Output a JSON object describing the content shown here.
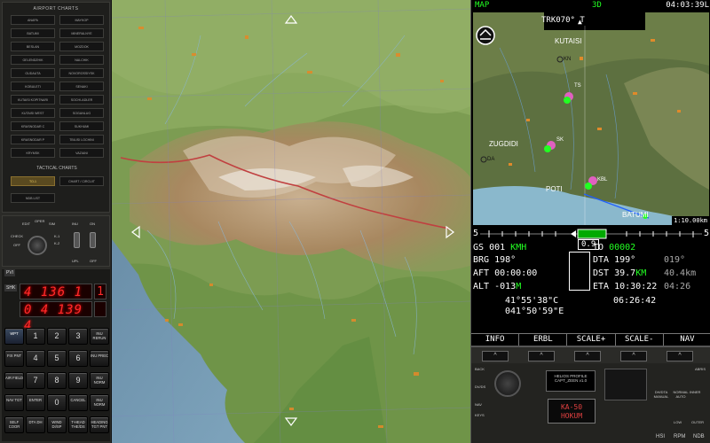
{
  "airport_charts": {
    "header": "AIRPORT CHARTS",
    "buttons": [
      [
        "ANAPA",
        "MAYKOP"
      ],
      [
        "BATUMI",
        "MINERALNYE"
      ],
      [
        "BESLAN",
        "MOZDOK"
      ],
      [
        "GELENDZHIK",
        "NALCHIK"
      ],
      [
        "GUDAUTA",
        "NOVOROSSIYSK"
      ],
      [
        "KOBULETI",
        "SENAKI"
      ],
      [
        "KUTAISI KOPITNARI",
        "SOCHI-ADLER"
      ],
      [
        "KUTAISI WEST",
        "SOGANLUG"
      ],
      [
        "KRASNODAR C",
        "SUKHUMI"
      ],
      [
        "KRASNODAR P",
        "TBILISI LOCHINI"
      ],
      [
        "KRYMSK",
        "VAZIANI"
      ]
    ]
  },
  "tactical_charts": {
    "header": "TACTICAL CHARTS",
    "buttons": [
      "TO-1",
      "CHART / CIRCUIT",
      "NDB LIST"
    ]
  },
  "mode_panel": {
    "labels": [
      "EDIT",
      "OPER",
      "SIM",
      "INU",
      "ON",
      "CHECK",
      "OFF",
      "K-1",
      "K-2",
      "UPL",
      "OFF"
    ]
  },
  "pvi": {
    "tag1": "PVI",
    "tag2": "SHK",
    "display1": "4 136 1",
    "display1r": "1",
    "display2": "0 4 139 4",
    "display2r": "",
    "keys": [
      [
        "WPT",
        "1",
        "2",
        "3",
        "INU RERUN"
      ],
      [
        "FIX PNT",
        "4",
        "5",
        "6",
        "INU PREC"
      ],
      [
        "AIR FIELD",
        "7",
        "8",
        "9",
        "INU NORM"
      ],
      [
        "NAV TGT",
        "ENTER",
        "0",
        "CANCEL",
        "INU NORM"
      ],
      [
        "SELF COOR",
        "DTA DH",
        "WIND DI/SP",
        "T-HEAD THE/DS",
        "HEADING TGT PNT"
      ]
    ]
  },
  "abris": {
    "mode": "MAP",
    "dim": "3D",
    "time": "04:03:39L",
    "track_label": "TRK",
    "track": "070° T",
    "scale": "1:10.00km",
    "places": [
      "KUTAISI",
      "ZUGDIDI",
      "POTI",
      "BATUMI"
    ],
    "wpts": [
      "KN",
      "TS",
      "SK",
      "DA",
      "KBL"
    ],
    "tape_left": "5",
    "tape_right": "5",
    "gs_label": "GS",
    "gs": "001",
    "gs_unit": "KMH",
    "brg_label": "BRG",
    "brg": "198°",
    "aft_label": "AFT",
    "aft": "00:00:00",
    "alt_label": "ALT",
    "alt": "-013",
    "alt_unit": "M",
    "lat": "41°55'38\"C",
    "lon": "041°50'59\"E",
    "dist_box": "0.9",
    "to_label": "TO",
    "to": "00002",
    "dta_label": "DTA",
    "dta": "199°",
    "dta2": "019°",
    "dst_label": "DST",
    "dst": "39.7",
    "dst_unit": "KM",
    "dst2": "40.4km",
    "eta_label": "ETA",
    "eta": "10:30:22",
    "eta2": "04:26",
    "ete": "06:26:42",
    "softkeys": [
      "INFO",
      "ERBL",
      "SCALE+",
      "SCALE-",
      "NAV"
    ],
    "panel_labels": [
      "BACK",
      "DV/DS",
      "NAV",
      "KEYS",
      "ABRIS",
      "HELIOS PROFILE CAPT_ZEEN v1.0",
      "KA-50 HOKUM",
      "HSI",
      "RPM",
      "NDB",
      "LOW",
      "OUTER",
      "INNER",
      "NORMAL AUTO",
      "DH/DTA MANUAL"
    ]
  }
}
